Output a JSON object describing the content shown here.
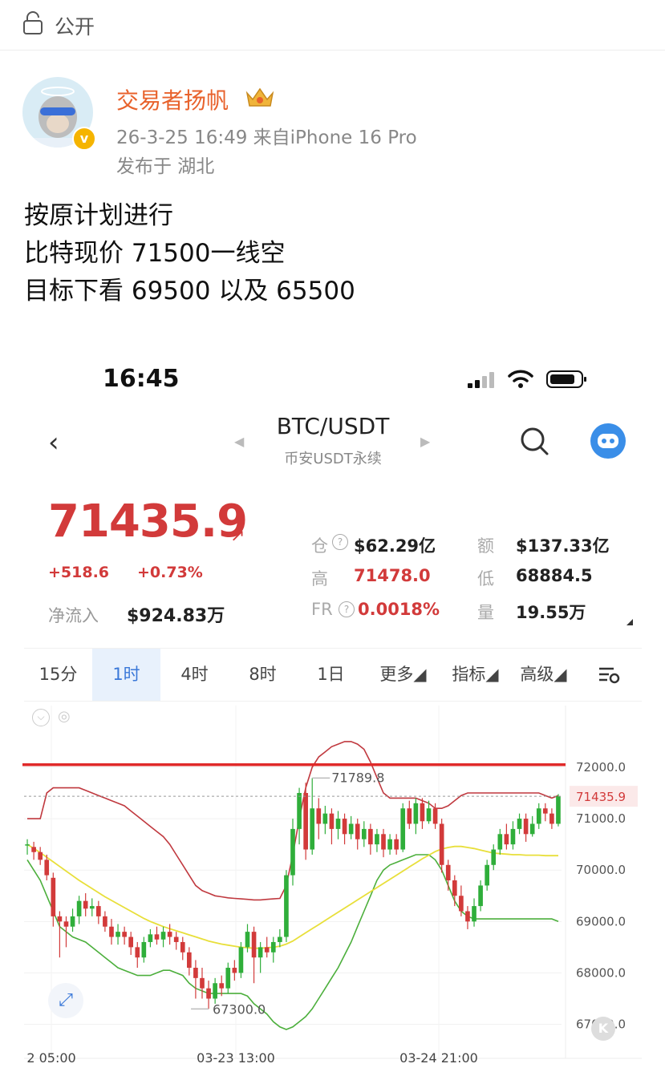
{
  "header": {
    "visibility": "公开"
  },
  "post": {
    "username": "交易者扬帆",
    "meta": "26-3-25 16:49  来自iPhone 16 Pro",
    "location": "发布于 湖北",
    "lines": [
      "按原计划进行",
      "比特现价 71500一线空",
      "目标下看 69500 以及 65500"
    ]
  },
  "screenshot": {
    "status_time": "16:45",
    "pair": "BTC/USDT",
    "pair_sub": "币安USDT永续",
    "price": "71435.9",
    "change": "+518.6",
    "change_pct": "+0.73%",
    "inflow_label": "净流入",
    "inflow_value": "$924.83万",
    "stats": {
      "open_interest_label": "仓",
      "open_interest": "$62.29亿",
      "turnover_label": "额",
      "turnover": "$137.33亿",
      "high_label": "高",
      "high": "71478.0",
      "low_label": "低",
      "low": "68884.5",
      "fr_label": "FR",
      "fr": "0.0018%",
      "volume_label": "量",
      "volume": "19.55万"
    },
    "tabs": [
      "15分",
      "1时",
      "4时",
      "8时",
      "1日",
      "更多",
      "指标",
      "高级"
    ],
    "active_tab": "1时",
    "colors": {
      "up": "#2fae3a",
      "down": "#d23a3a",
      "accent": "#3a78d8",
      "name": "#e8622c"
    }
  },
  "chart_data": {
    "type": "candlestick",
    "y_ticks": [
      "72000.0",
      "71000.0",
      "70000.0",
      "69000.0",
      "68000.0",
      "67000.0"
    ],
    "ylim": [
      66650,
      73200
    ],
    "x_ticks": [
      "2 05:00",
      "03-23 13:00",
      "03-24 21:00"
    ],
    "current_price_label": "71435.9",
    "annotations": {
      "high": "71789.8",
      "low": "67300.0"
    },
    "resistance_line": 72050,
    "candles": [
      [
        70500,
        70500,
        70600,
        70300
      ],
      [
        70450,
        70350,
        70550,
        70200
      ],
      [
        70350,
        70200,
        70450,
        70100
      ],
      [
        70200,
        69900,
        70300,
        69800
      ],
      [
        69850,
        69100,
        69950,
        68900
      ],
      [
        69100,
        69000,
        69200,
        68300
      ],
      [
        69000,
        68900,
        69100,
        68500
      ],
      [
        68900,
        69100,
        69250,
        68800
      ],
      [
        69100,
        69400,
        69500,
        68950
      ],
      [
        69400,
        69250,
        69550,
        69100
      ],
      [
        69250,
        69300,
        69450,
        69100
      ],
      [
        69300,
        69100,
        69400,
        68950
      ],
      [
        69100,
        68900,
        69200,
        68800
      ],
      [
        68900,
        68700,
        69050,
        68550
      ],
      [
        68700,
        68800,
        68950,
        68550
      ],
      [
        68800,
        68700,
        68900,
        68550
      ],
      [
        68700,
        68500,
        68800,
        68350
      ],
      [
        68500,
        68300,
        68600,
        68100
      ],
      [
        68300,
        68600,
        68700,
        68200
      ],
      [
        68600,
        68750,
        68850,
        68500
      ],
      [
        68750,
        68650,
        68900,
        68550
      ],
      [
        68650,
        68800,
        68900,
        68500
      ],
      [
        68800,
        68700,
        68950,
        68550
      ],
      [
        68700,
        68600,
        68800,
        68450
      ],
      [
        68600,
        68400,
        68700,
        68250
      ],
      [
        68400,
        68100,
        68500,
        67950
      ],
      [
        68100,
        67900,
        68250,
        67500
      ],
      [
        67900,
        67700,
        68100,
        67500
      ],
      [
        67700,
        67500,
        67850,
        67300
      ],
      [
        67500,
        67800,
        67900,
        67400
      ],
      [
        67800,
        67700,
        67950,
        67550
      ],
      [
        67700,
        68100,
        68200,
        67600
      ],
      [
        68100,
        68000,
        68250,
        67850
      ],
      [
        68000,
        68500,
        68600,
        67900
      ],
      [
        68500,
        68800,
        68950,
        68400
      ],
      [
        68800,
        68300,
        68900,
        67800
      ],
      [
        68300,
        68500,
        68600,
        68000
      ],
      [
        68500,
        68400,
        68700,
        68300
      ],
      [
        68400,
        68600,
        68700,
        68200
      ],
      [
        68600,
        68700,
        68850,
        68500
      ],
      [
        68700,
        69900,
        70000,
        68600
      ],
      [
        69900,
        70800,
        71000,
        69700
      ],
      [
        70800,
        71500,
        71600,
        70500
      ],
      [
        71500,
        70400,
        71700,
        70200
      ],
      [
        70400,
        71200,
        71789.8,
        70300
      ],
      [
        71200,
        70900,
        71400,
        70600
      ],
      [
        70900,
        71100,
        71250,
        70700
      ],
      [
        71100,
        70800,
        71200,
        70500
      ],
      [
        70800,
        71000,
        71150,
        70600
      ],
      [
        71000,
        70700,
        71100,
        70500
      ],
      [
        70700,
        70900,
        71050,
        70600
      ],
      [
        70900,
        70600,
        71000,
        70400
      ],
      [
        70600,
        70800,
        70950,
        70450
      ],
      [
        70800,
        70500,
        70900,
        70300
      ],
      [
        70500,
        70700,
        70800,
        70350
      ],
      [
        70700,
        70400,
        70800,
        70250
      ],
      [
        70400,
        70600,
        70700,
        70300
      ],
      [
        70600,
        70400,
        70700,
        70300
      ],
      [
        70400,
        71200,
        71300,
        70350
      ],
      [
        71200,
        70900,
        71350,
        70800
      ],
      [
        70900,
        71300,
        71400,
        70700
      ],
      [
        71300,
        70950,
        71400,
        70800
      ],
      [
        70950,
        71200,
        71350,
        70900
      ],
      [
        71200,
        70900,
        71300,
        70800
      ],
      [
        70900,
        70100,
        71000,
        69950
      ],
      [
        70100,
        69800,
        70200,
        69600
      ],
      [
        69800,
        69500,
        69900,
        69300
      ],
      [
        69500,
        69200,
        69700,
        69100
      ],
      [
        69200,
        69000,
        69300,
        68850
      ],
      [
        69000,
        69300,
        69450,
        68900
      ],
      [
        69300,
        69700,
        69800,
        69200
      ],
      [
        69700,
        70100,
        70200,
        69600
      ],
      [
        70100,
        70400,
        70500,
        70000
      ],
      [
        70400,
        70700,
        70800,
        70300
      ],
      [
        70700,
        70500,
        70900,
        70400
      ],
      [
        70500,
        70800,
        70950,
        70400
      ],
      [
        70800,
        71000,
        71100,
        70700
      ],
      [
        71000,
        70700,
        71100,
        70550
      ],
      [
        70700,
        70900,
        71050,
        70650
      ],
      [
        70900,
        71200,
        71300,
        70800
      ],
      [
        71200,
        71100,
        71300,
        70950
      ],
      [
        71100,
        70900,
        71200,
        70800
      ],
      [
        70900,
        71435.9,
        71478,
        70850
      ]
    ],
    "ma": [
      70500,
      70420,
      70340,
      70250,
      70160,
      70070,
      69980,
      69890,
      69800,
      69720,
      69640,
      69560,
      69480,
      69410,
      69340,
      69270,
      69200,
      69130,
      69060,
      69000,
      68950,
      68900,
      68860,
      68820,
      68780,
      68740,
      68700,
      68660,
      68620,
      68590,
      68560,
      68540,
      68520,
      68500,
      68490,
      68480,
      68480,
      68490,
      68500,
      68520,
      68560,
      68620,
      68700,
      68780,
      68860,
      68940,
      69020,
      69100,
      69180,
      69260,
      69340,
      69420,
      69500,
      69580,
      69660,
      69740,
      69820,
      69900,
      69980,
      70060,
      70140,
      70220,
      70290,
      70360,
      70410,
      70440,
      70460,
      70460,
      70440,
      70420,
      70390,
      70360,
      70330,
      70320,
      70310,
      70300,
      70300,
      70290,
      70290,
      70290,
      70280,
      70280,
      70280
    ],
    "upper": [
      71000,
      71000,
      71000,
      71500,
      71600,
      71600,
      71600,
      71600,
      71600,
      71550,
      71500,
      71450,
      71400,
      71350,
      71300,
      71250,
      71150,
      71050,
      70950,
      70850,
      70750,
      70650,
      70500,
      70300,
      70100,
      69900,
      69700,
      69600,
      69550,
      69500,
      69480,
      69460,
      69450,
      69440,
      69430,
      69420,
      69420,
      69430,
      69440,
      69450,
      69700,
      70300,
      71000,
      71600,
      72000,
      72200,
      72300,
      72400,
      72450,
      72500,
      72500,
      72450,
      72350,
      72100,
      71800,
      71500,
      71400,
      71400,
      71400,
      71400,
      71400,
      71350,
      71300,
      71200,
      71200,
      71250,
      71350,
      71450,
      71500,
      71500,
      71500,
      71500,
      71500,
      71500,
      71500,
      71500,
      71500,
      71500,
      71500,
      71500,
      71450,
      71400,
      71450
    ],
    "lower": [
      70200,
      70000,
      69800,
      69500,
      69200,
      68900,
      68800,
      68700,
      68650,
      68600,
      68500,
      68400,
      68300,
      68200,
      68100,
      68050,
      68000,
      67950,
      67950,
      67950,
      68000,
      68050,
      68050,
      68000,
      67950,
      67800,
      67700,
      67650,
      67600,
      67600,
      67600,
      67600,
      67600,
      67600,
      67550,
      67400,
      67300,
      67200,
      67050,
      66950,
      66900,
      66950,
      67050,
      67150,
      67300,
      67500,
      67700,
      67900,
      68100,
      68350,
      68600,
      68900,
      69200,
      69500,
      69800,
      70000,
      70100,
      70150,
      70200,
      70250,
      70300,
      70300,
      70300,
      70200,
      70000,
      69700,
      69400,
      69200,
      69100,
      69050,
      69050,
      69050,
      69050,
      69050,
      69050,
      69050,
      69050,
      69050,
      69050,
      69050,
      69050,
      69050,
      69000
    ]
  }
}
